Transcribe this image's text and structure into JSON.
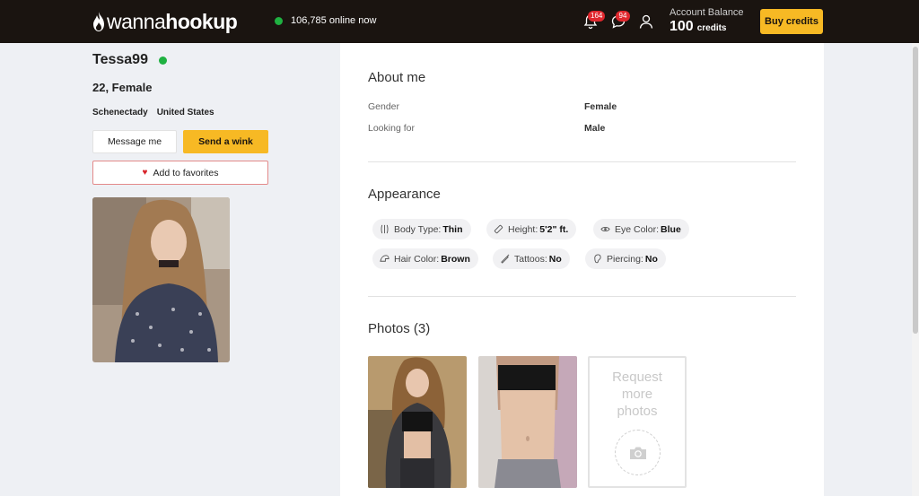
{
  "header": {
    "logo_light": "wanna",
    "logo_bold": "hookup",
    "online_text": "106,785 online now",
    "notifications_count": "164",
    "messages_count": "94",
    "balance_label": "Account Balance",
    "balance_amount": "100",
    "balance_unit": "credits",
    "buy_label": "Buy credits"
  },
  "profile": {
    "username": "Tessa99",
    "age_gender": "22, Female",
    "city": "Schenectady",
    "country": "United States",
    "message_label": "Message me",
    "wink_label": "Send a wink",
    "favorite_label": "Add to favorites"
  },
  "about": {
    "title": "About me",
    "rows": [
      {
        "label": "Gender",
        "value": "Female"
      },
      {
        "label": "Looking for",
        "value": "Male"
      }
    ]
  },
  "appearance": {
    "title": "Appearance",
    "chips": [
      {
        "label": "Body Type:",
        "value": "Thin",
        "icon": "body-icon"
      },
      {
        "label": "Height:",
        "value": "5'2\" ft.",
        "icon": "ruler-icon"
      },
      {
        "label": "Eye Color:",
        "value": "Blue",
        "icon": "eye-icon"
      },
      {
        "label": "Hair Color:",
        "value": "Brown",
        "icon": "hair-icon"
      },
      {
        "label": "Tattoos:",
        "value": "No",
        "icon": "tattoo-icon"
      },
      {
        "label": "Piercing:",
        "value": "No",
        "icon": "ear-icon"
      }
    ]
  },
  "photos": {
    "title": "Photos (3)",
    "request_text_1": "Request",
    "request_text_2": "more",
    "request_text_3": "photos"
  },
  "colors": {
    "accent": "#f7b924",
    "header_bg": "#1a1410",
    "online_green": "#1fb141",
    "badge_red": "#e0282e"
  }
}
